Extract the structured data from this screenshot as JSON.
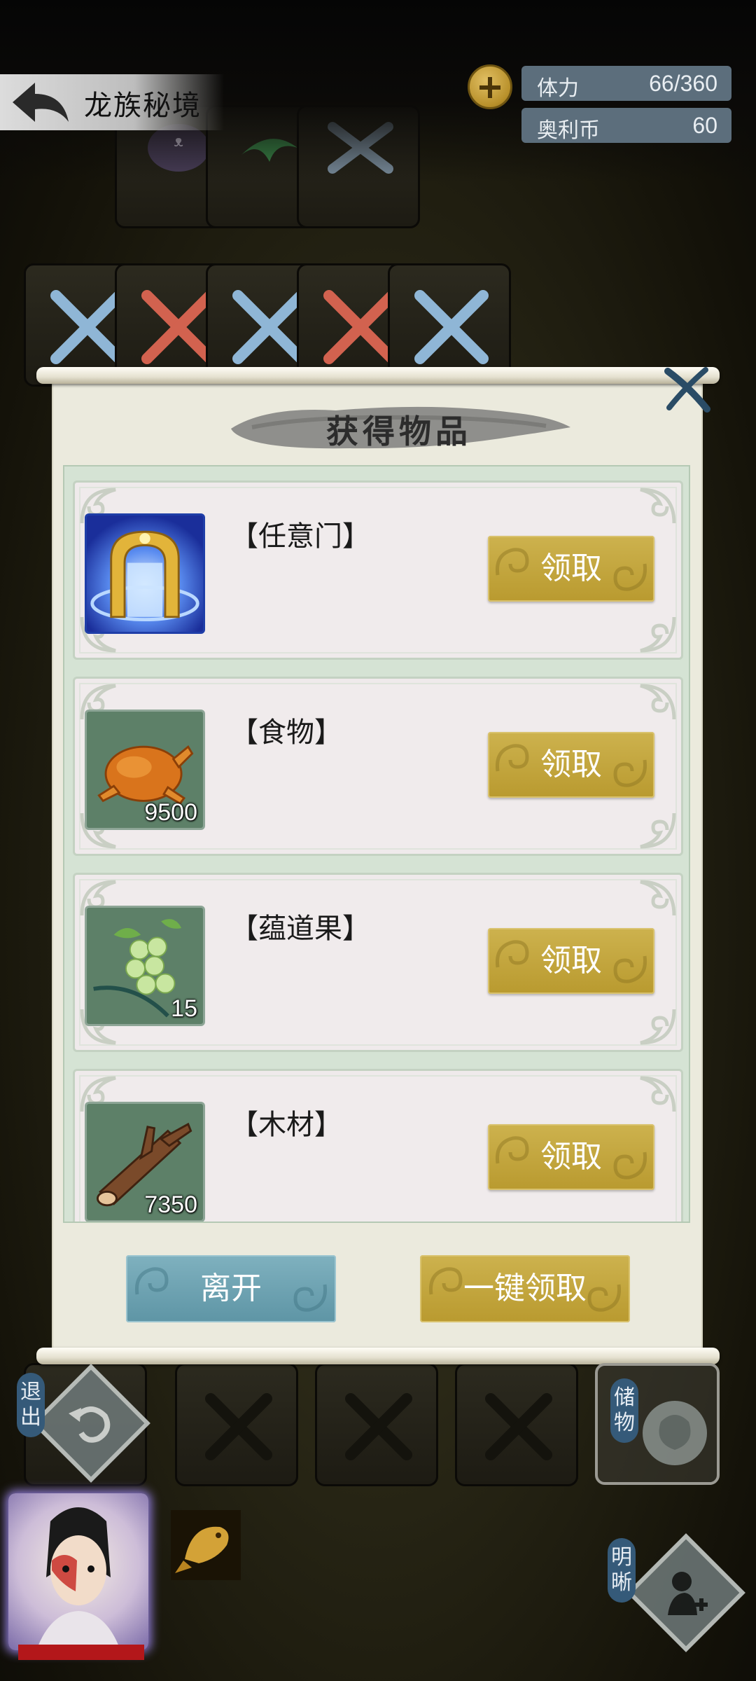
{
  "header": {
    "title": "龙族秘境",
    "stamina_label": "体力",
    "stamina_value": "66/360",
    "coin_label": "奥利币",
    "coin_value": "60"
  },
  "popup": {
    "title": "获得物品",
    "items": [
      {
        "name": "【任意门】",
        "count": "",
        "icon": "golden-gate-icon",
        "claim_label": "领取"
      },
      {
        "name": "【食物】",
        "count": "9500",
        "icon": "roast-chicken-icon",
        "claim_label": "领取"
      },
      {
        "name": "【蕴道果】",
        "count": "15",
        "icon": "green-fruit-branch-icon",
        "claim_label": "领取"
      },
      {
        "name": "【木材】",
        "count": "7350",
        "icon": "wood-log-icon",
        "claim_label": "领取"
      }
    ],
    "leave_label": "离开",
    "claim_all_label": "一键领取"
  },
  "hud": {
    "exit_label": "退出",
    "storage_label": "储物",
    "clear_label": "明晰"
  },
  "colors": {
    "claim_gold": "#c4a73f",
    "leave_teal": "#6fa3b2",
    "stat_bar": "#5c6e7c",
    "hp_red": "#b3171a"
  }
}
